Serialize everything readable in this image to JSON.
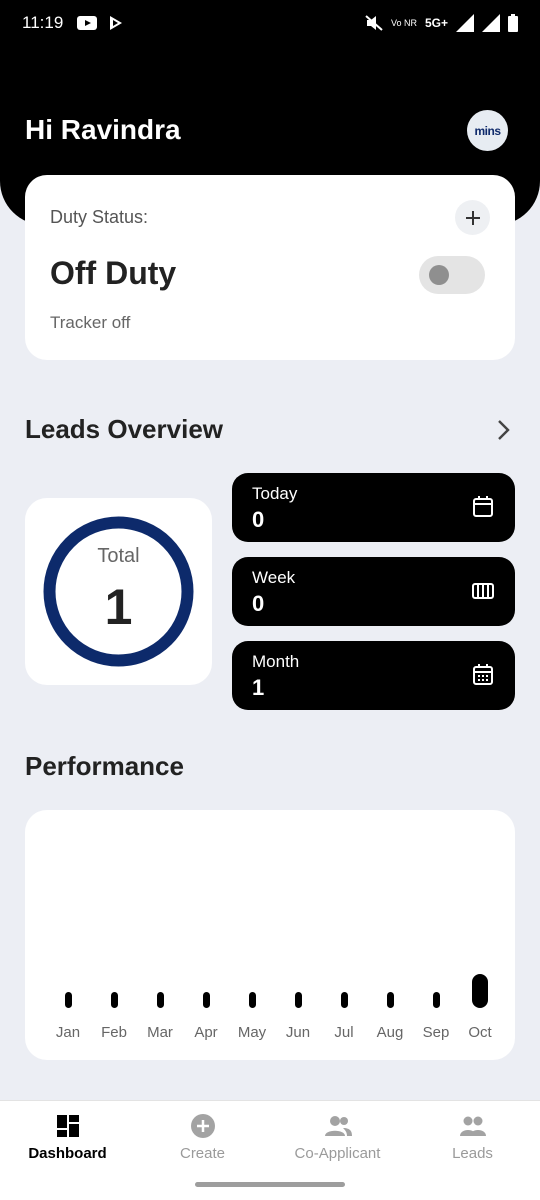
{
  "status_bar": {
    "time": "11:19",
    "network": "5G+",
    "carrier_small": "Vo NR"
  },
  "header": {
    "greeting": "Hi Ravindra",
    "avatar_text": "mins"
  },
  "duty": {
    "label": "Duty Status:",
    "state": "Off Duty",
    "tracker": "Tracker off",
    "toggle_on": false
  },
  "leads_overview": {
    "title": "Leads Overview",
    "total_label": "Total",
    "total_value": "1",
    "stats": [
      {
        "label": "Today",
        "value": "0",
        "icon": "calendar-icon"
      },
      {
        "label": "Week",
        "value": "0",
        "icon": "week-grid-icon"
      },
      {
        "label": "Month",
        "value": "1",
        "icon": "calendar-month-icon"
      }
    ]
  },
  "performance": {
    "title": "Performance"
  },
  "chart_data": {
    "type": "bar",
    "categories": [
      "Jan",
      "Feb",
      "Mar",
      "Apr",
      "May",
      "Jun",
      "Jul",
      "Aug",
      "Sep",
      "Oct"
    ],
    "values": [
      0,
      0,
      0,
      0,
      0,
      0,
      0,
      0,
      0,
      1
    ],
    "grid": false
  },
  "bottom_nav": [
    {
      "label": "Dashboard",
      "icon": "dashboard-icon",
      "active": true
    },
    {
      "label": "Create",
      "icon": "add-circle-icon",
      "active": false
    },
    {
      "label": "Co-Applicant",
      "icon": "group-icon",
      "active": false
    },
    {
      "label": "Leads",
      "icon": "people-icon",
      "active": false
    }
  ],
  "colors": {
    "accent": "#0d2a6b",
    "header": "#000000",
    "background": "#eceef4"
  }
}
